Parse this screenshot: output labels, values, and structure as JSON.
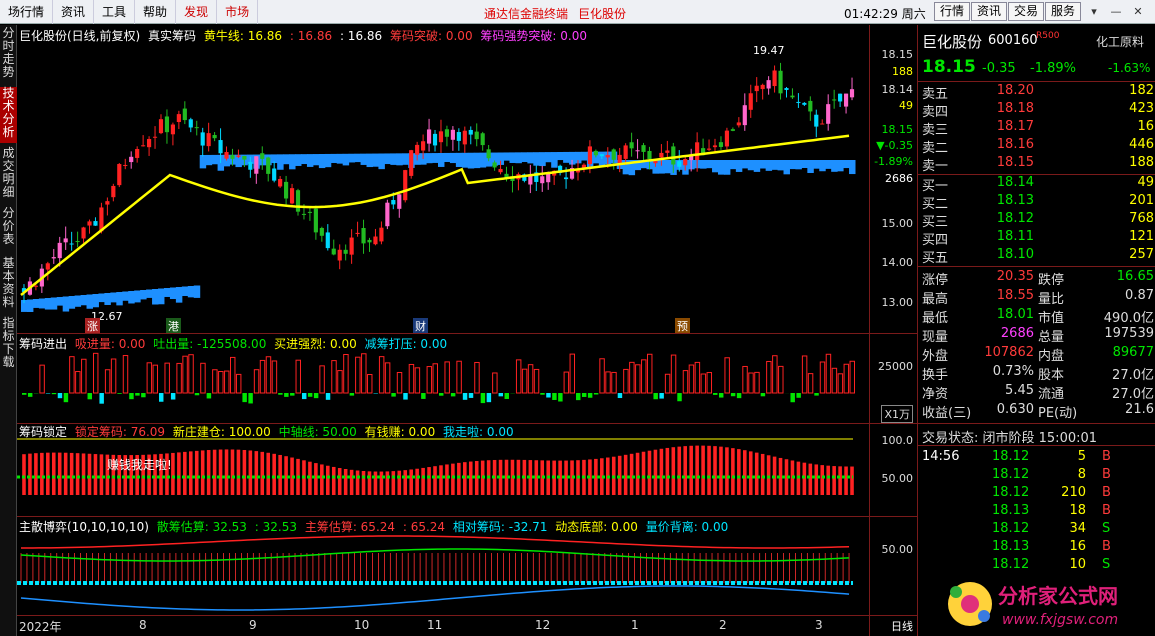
{
  "menu": {
    "items": [
      "场行情",
      "资讯",
      "工具",
      "帮助",
      "发现",
      "市场"
    ],
    "promo": "通达信金融终端",
    "promo2": "巨化股份",
    "clock": "01:42:29 周六",
    "rbtns": [
      "行情",
      "资讯",
      "交易",
      "服务"
    ]
  },
  "sidebar": [
    "分时走势",
    "技术分析",
    "成交明细",
    "分价表",
    "基本资料",
    "指标下载"
  ],
  "main": {
    "title": "巨化股份(日线,前复权)",
    "indicator": "真实筹码",
    "p1": "黄牛线: 16.86",
    "p2": ": 16.86",
    "p3": ": 16.86",
    "p4": "筹码突破: 0.00",
    "p5": "筹码强势突破: 0.00",
    "hi_label": "19.47",
    "lo_label": "12.67",
    "markers": [
      "涨",
      "港",
      "财",
      "预"
    ]
  },
  "price_axis": [
    "18.15",
    "188",
    "18.14",
    "49",
    "18.15",
    "▼-0.35",
    "-1.89%",
    "2686",
    "15.00",
    "14.00",
    "13.00"
  ],
  "p2": {
    "name": "筹码进出",
    "a": "吸进量: 0.00",
    "b": "吐出量: -125508.00",
    "c": "买进强烈: 0.00",
    "d": "减筹打压: 0.00",
    "tick": "25000",
    "unit": "X1万"
  },
  "p3": {
    "name": "筹码锁定",
    "a": "锁定筹码: 76.09",
    "b": "新庄建仓: 100.00",
    "c": "中轴线: 50.00",
    "d": "有钱赚: 0.00",
    "e": "我走啦: 0.00",
    "tick1": "100.0",
    "tick2": "50.00",
    "note": "赚钱我走啦!"
  },
  "p4": {
    "name": "主散博弈(10,10,10,10)",
    "a": "散筹估算: 32.53",
    "b": ": 32.53",
    "c": "主筹估算: 65.24",
    "d": ": 65.24",
    "e": "相对筹码: -32.71",
    "f": "动态底部: 0.00",
    "g": "量价背离: 0.00",
    "tick": "50.00"
  },
  "xaxis": [
    "2022年",
    "8",
    "9",
    "10",
    "11",
    "12",
    "1",
    "2",
    "3"
  ],
  "period": "日线",
  "quote": {
    "name": "巨化股份",
    "code": "600160",
    "tag": "R500",
    "sector": "化工原料",
    "sector_chg": "-1.63%",
    "price": "18.15",
    "chg": "-0.35",
    "pct": "-1.89%",
    "sells": [
      [
        "卖五",
        "18.20",
        "182"
      ],
      [
        "卖四",
        "18.18",
        "423"
      ],
      [
        "卖三",
        "18.17",
        "16"
      ],
      [
        "卖二",
        "18.16",
        "446"
      ],
      [
        "卖一",
        "18.15",
        "188"
      ]
    ],
    "buys": [
      [
        "买一",
        "18.14",
        "49"
      ],
      [
        "买二",
        "18.13",
        "201"
      ],
      [
        "买三",
        "18.12",
        "768"
      ],
      [
        "买四",
        "18.11",
        "121"
      ],
      [
        "买五",
        "18.10",
        "257"
      ]
    ],
    "stats": [
      [
        "涨停",
        "20.35",
        "跌停",
        "16.65"
      ],
      [
        "最高",
        "18.55",
        "量比",
        "0.87"
      ],
      [
        "最低",
        "18.01",
        "市值",
        "490.0亿"
      ],
      [
        "现量",
        "2686",
        "总量",
        "197539"
      ],
      [
        "外盘",
        "107862",
        "内盘",
        "89677"
      ],
      [
        "换手",
        "0.73%",
        "股本",
        "27.0亿"
      ],
      [
        "净资",
        "5.45",
        "流通",
        "27.0亿"
      ],
      [
        "收益(三)",
        "0.630",
        "PE(动)",
        "21.6"
      ]
    ],
    "status": "交易状态: 闭市阶段 15:00:01",
    "ticks": [
      [
        "14:56",
        "18.12",
        "5",
        "B"
      ],
      [
        "",
        "18.12",
        "8",
        "B"
      ],
      [
        "",
        "18.12",
        "210",
        "B"
      ],
      [
        "",
        "18.13",
        "18",
        "B"
      ],
      [
        "",
        "18.12",
        "34",
        "S"
      ],
      [
        "",
        "18.13",
        "16",
        "B"
      ],
      [
        "",
        "18.12",
        "10",
        "S"
      ]
    ]
  },
  "watermark": {
    "line1": "分析家公式网",
    "line2": "www.fxjgsw.com"
  }
}
